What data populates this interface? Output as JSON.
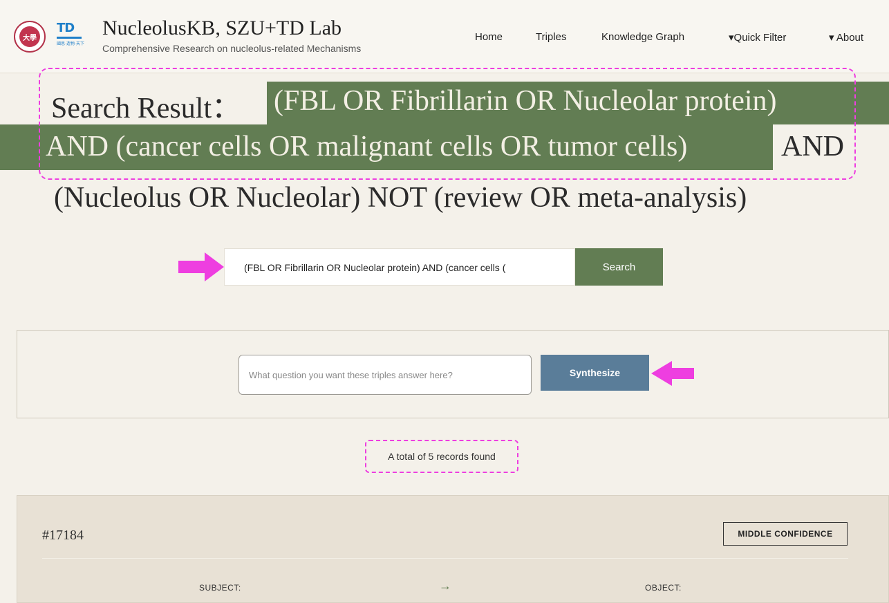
{
  "header": {
    "seal_text": "大學",
    "td_mark": "TD",
    "td_text": "國思·造物·天下",
    "title": "NucleolusKB, SZU+TD Lab",
    "subtitle": "Comprehensive Research on nucleolus-related Mechanisms",
    "nav": [
      "Home",
      "Triples",
      "Knowledge Graph",
      "▾Quick Filter",
      "▾ About"
    ]
  },
  "result": {
    "label": "Search Result：",
    "query_part1": "(FBL OR Fibrillarin OR Nucleolar protein)",
    "query_part2": "AND (cancer cells OR malignant cells OR tumor cells)",
    "query_part3": "AND",
    "query_part4": "(Nucleolus OR Nucleolar) NOT (review OR meta-analysis)"
  },
  "search": {
    "value": "(FBL OR Fibrillarin OR Nucleolar protein) AND (cancer cells (",
    "button": "Search"
  },
  "synth": {
    "placeholder": "What question you want these triples answer here?",
    "button": "Synthesize"
  },
  "records_text": "A total of 5 records found",
  "card": {
    "id": "#17184",
    "confidence": "MIDDLE CONFIDENCE",
    "subject_label": "SUBJECT:",
    "arrow": "→",
    "object_label": "OBJECT:"
  },
  "colors": {
    "accent_green": "#627d53",
    "synth_blue": "#5a7d99",
    "annotation_magenta": "#ee3ee0"
  }
}
